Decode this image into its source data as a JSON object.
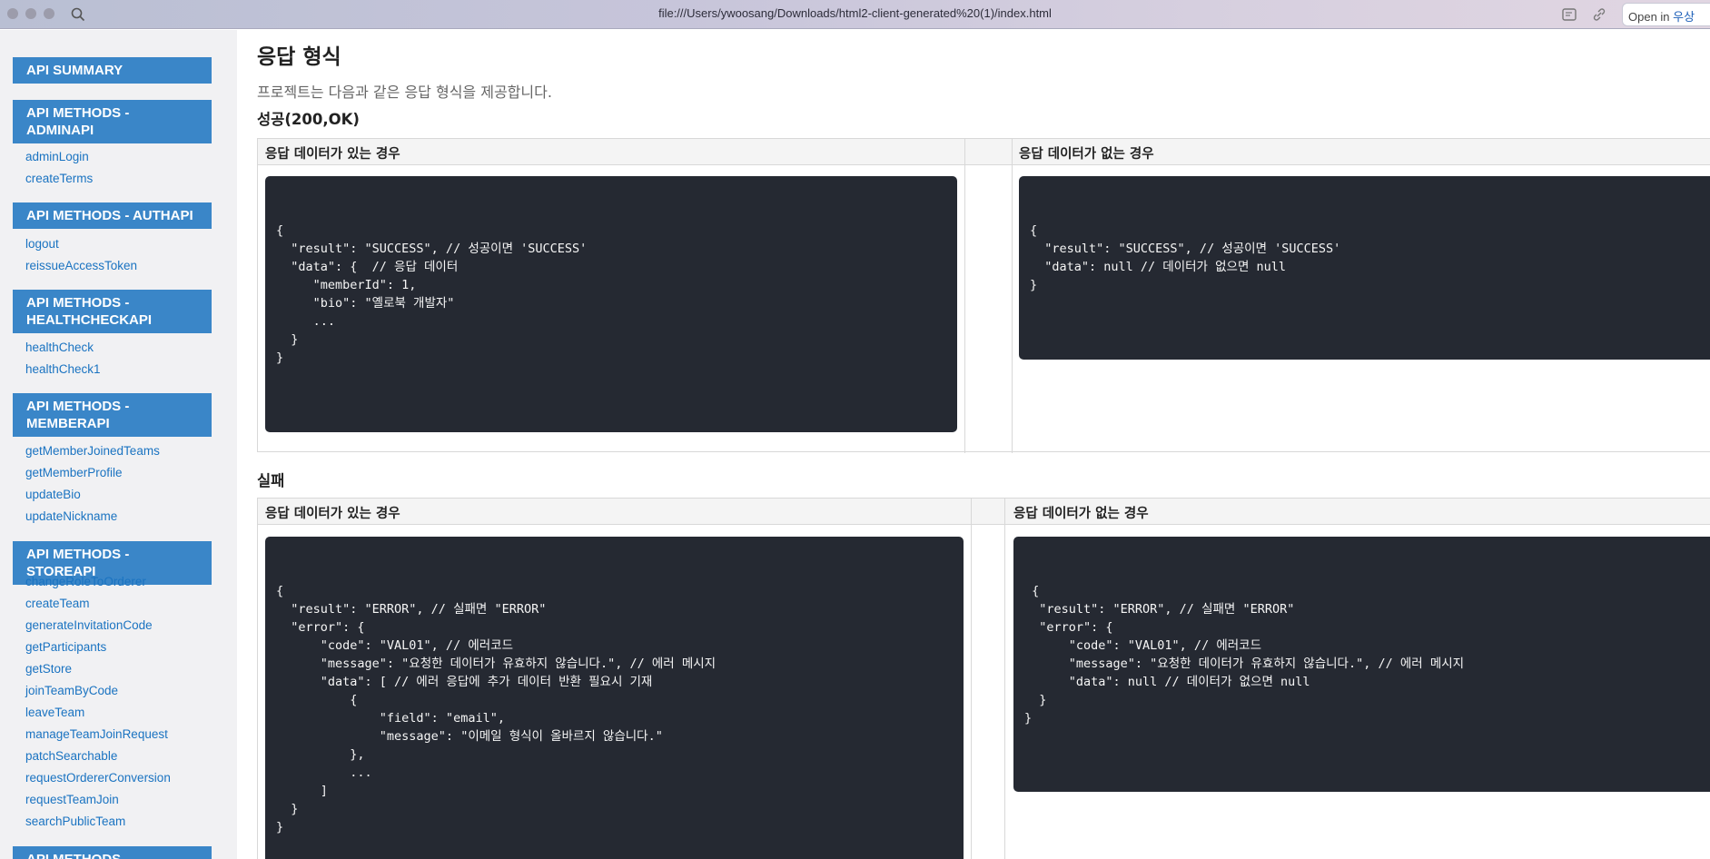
{
  "browser": {
    "url": "file:///Users/ywoosang/Downloads/html2-client-generated%20(1)/index.html",
    "open_in_label": "Open in",
    "open_in_target": "우상"
  },
  "sidebar": {
    "summary": "API SUMMARY",
    "sections": [
      {
        "title": "API METHODS - ADMINAPI",
        "items": [
          "adminLogin",
          "createTerms"
        ]
      },
      {
        "title": "API METHODS - AUTHAPI",
        "items": [
          "logout",
          "reissueAccessToken"
        ]
      },
      {
        "title": "API METHODS - HEALTHCHECKAPI",
        "items": [
          "healthCheck",
          "healthCheck1"
        ]
      },
      {
        "title": "API METHODS - MEMBERAPI",
        "items": [
          "getMemberJoinedTeams",
          "getMemberProfile",
          "updateBio",
          "updateNickname"
        ]
      },
      {
        "title": "API METHODS - STOREAPI",
        "items": [
          "changeRoleToOrderer",
          "createTeam",
          "generateInvitationCode",
          "getParticipants",
          "getStore",
          "joinTeamByCode",
          "leaveTeam",
          "manageTeamJoinRequest",
          "patchSearchable",
          "requestOrdererConversion",
          "requestTeamJoin",
          "searchPublicTeam"
        ]
      },
      {
        "title": "API METHODS",
        "items": []
      }
    ]
  },
  "main": {
    "title": "응답 형식",
    "intro": "프로젝트는 다음과 같은 응답 형식을 제공합니다.",
    "success": {
      "heading": "성공(200,OK)",
      "col_with": "응답 데이터가 있는 경우",
      "col_without": "응답 데이터가 없는 경우",
      "code_with": "{\n  \"result\": \"SUCCESS\", // 성공이면 'SUCCESS'\n  \"data\": {  // 응답 데이터\n     \"memberId\": 1,\n     \"bio\": \"옐로북 개발자\"\n     ...\n  }\n}",
      "code_without": "{\n  \"result\": \"SUCCESS\", // 성공이면 'SUCCESS'\n  \"data\": null // 데이터가 없으면 null\n}"
    },
    "failure": {
      "heading": "실패",
      "col_with": "응답 데이터가 있는 경우",
      "col_without": "응답 데이터가 없는 경우",
      "code_with": "{\n  \"result\": \"ERROR\", // 실패면 \"ERROR\"\n  \"error\": {\n      \"code\": \"VAL01\", // 에러코드\n      \"message\": \"요청한 데이터가 유효하지 않습니다.\", // 에러 메시지\n      \"data\": [ // 에러 응답에 추가 데이터 반환 필요시 기재\n          {\n              \"field\": \"email\",\n              \"message\": \"이메일 형식이 올바르지 않습니다.\"\n          },\n          ...\n      ]\n  }\n}",
      "code_without": " {\n  \"result\": \"ERROR\", // 실패면 \"ERROR\"\n  \"error\": {\n      \"code\": \"VAL01\", // 에러코드\n      \"message\": \"요청한 데이터가 유효하지 않습니다.\", // 에러 메시지\n      \"data\": null // 데이터가 없으면 null\n  }\n}"
    }
  }
}
